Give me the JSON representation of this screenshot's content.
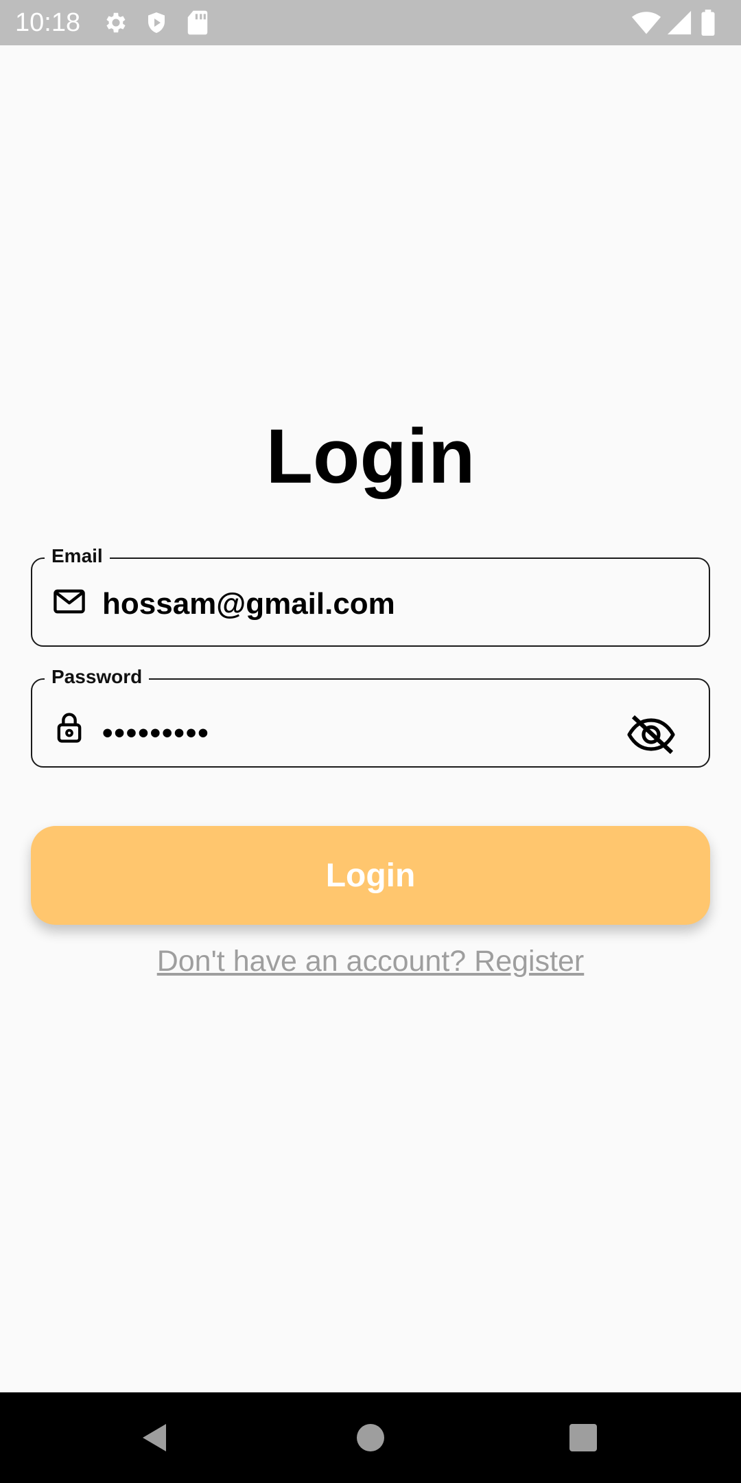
{
  "status_bar": {
    "time": "10:18",
    "icons_left": [
      "settings-icon",
      "shield-play-icon",
      "sd-card-icon"
    ],
    "icons_right": [
      "wifi-icon",
      "signal-icon",
      "battery-icon"
    ]
  },
  "page": {
    "title": "Login"
  },
  "email_field": {
    "label": "Email",
    "value": "hossam@gmail.com",
    "icon": "mail-icon"
  },
  "password_field": {
    "label": "Password",
    "value": "•••••••••",
    "icon": "lock-icon",
    "toggle_icon": "eye-off-icon"
  },
  "login_button": {
    "label": "Login",
    "color": "#ffc66e"
  },
  "register_link": {
    "text": "Don't have an account? Register"
  },
  "nav_bar": {
    "buttons": [
      "back-icon",
      "home-icon",
      "recents-icon"
    ]
  }
}
